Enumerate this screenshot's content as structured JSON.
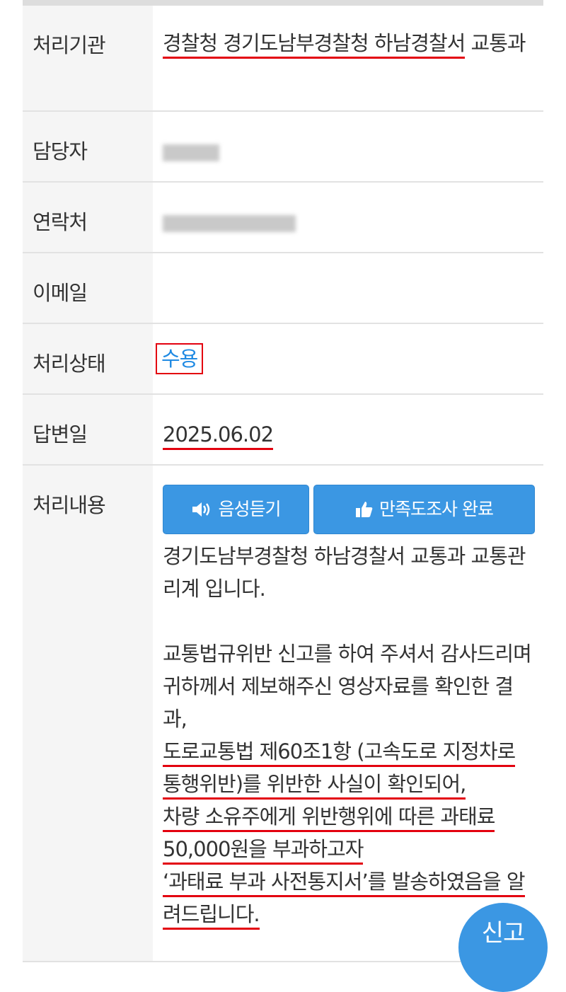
{
  "rows": {
    "agency": {
      "label": "처리기관",
      "value_underlined": "경찰청 경기도남부경찰청 하남경찰서",
      "value_rest": " 교통과"
    },
    "manager": {
      "label": "담당자"
    },
    "contact": {
      "label": "연락처"
    },
    "email": {
      "label": "이메일",
      "value": ""
    },
    "status": {
      "label": "처리상태",
      "value": "수용"
    },
    "answer_date": {
      "label": "답변일",
      "value": "2025.06.02"
    },
    "content": {
      "label": "처리내용",
      "voice_button": "음성듣기",
      "survey_button": "만족도조사 완료",
      "para1": "경기도남부경찰청 하남경찰서 교통과 교통관리계 입니다.",
      "para2": "교통법규위반 신고를 하여 주셔서 감사드리며 귀하께서 제보해주신 영상자료를 확인한 결과,",
      "line_a": "도로교통법 제60조1항 (고속도로 지정차로 통행위반)를 위반한 사실이 확인되어,",
      "line_b": "차량 소유주에게 위반행위에 따른 과태료 50,000원을 부과하고자",
      "line_c": "‘과태료 부과 사전통지서’를 발송하였음을 알려드립니다."
    }
  },
  "fab": {
    "label": "신고"
  },
  "colors": {
    "accent": "#3b97e3",
    "underline": "#e3000f",
    "status_text": "#1f8ae3"
  },
  "icons": {
    "voice": "speaker-icon",
    "survey": "thumbs-up-icon"
  }
}
